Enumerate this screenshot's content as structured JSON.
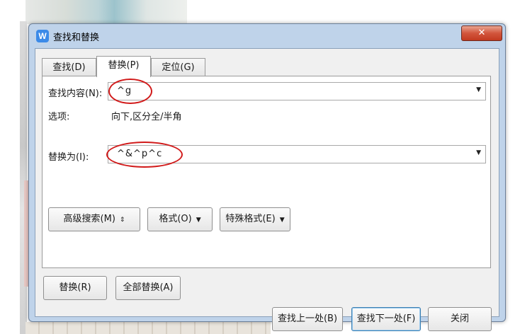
{
  "window": {
    "title": "查找和替换",
    "app_icon": "W",
    "close_label": "✕"
  },
  "tabs": [
    {
      "label": "查找(D)"
    },
    {
      "label": "替换(P)"
    },
    {
      "label": "定位(G)"
    }
  ],
  "replace_tab": {
    "find_label": "查找内容(N):",
    "find_value": "^g",
    "options_label": "选项:",
    "options_value": "向下,区分全/半角",
    "replace_label": "替换为(I):",
    "replace_value": "^&^p^c",
    "advanced_button": "高级搜索(M)",
    "format_button": "格式(O)",
    "special_button": "特殊格式(E)"
  },
  "actions": {
    "replace": "替换(R)",
    "replace_all": "全部替换(A)",
    "find_prev": "查找上一处(B)",
    "find_next": "查找下一处(F)",
    "close": "关闭"
  },
  "colors": {
    "annotation_ring": "#d11a1a",
    "title_bar": "#bfd3ea",
    "close_button": "#c8452a"
  }
}
